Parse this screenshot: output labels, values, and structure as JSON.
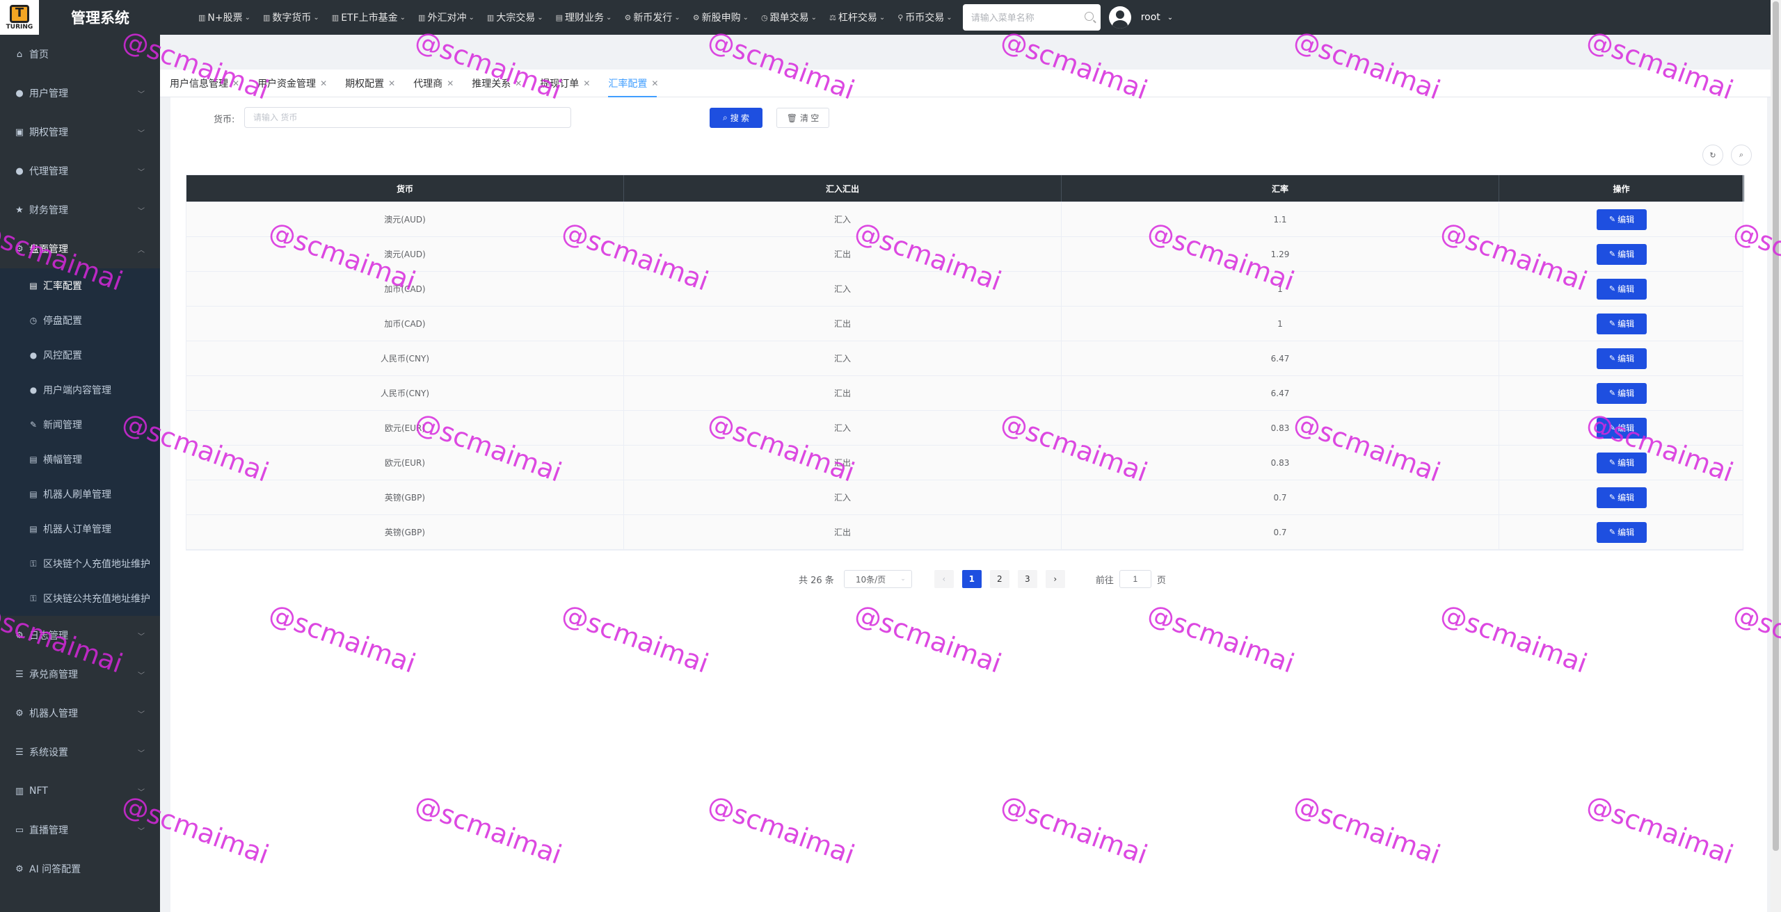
{
  "app": {
    "logo_text": "TURING",
    "logo_mark": "T",
    "title": "管理系统"
  },
  "topnav": [
    {
      "label": "N+股票",
      "icon": "chart-icon"
    },
    {
      "label": "数字货币",
      "icon": "chart-icon"
    },
    {
      "label": "ETF上市基金",
      "icon": "chart-icon"
    },
    {
      "label": "外汇对冲",
      "icon": "chart-icon"
    },
    {
      "label": "大宗交易",
      "icon": "chart-icon"
    },
    {
      "label": "理财业务",
      "icon": "document-icon"
    },
    {
      "label": "新币发行",
      "icon": "gear-icon"
    },
    {
      "label": "新股申购",
      "icon": "gear-icon"
    },
    {
      "label": "跟单交易",
      "icon": "clock-icon"
    },
    {
      "label": "杠杆交易",
      "icon": "scale-icon"
    },
    {
      "label": "币币交易",
      "icon": "pin-icon"
    }
  ],
  "menu_search": {
    "placeholder": "请输入菜单名称"
  },
  "user": {
    "name": "root"
  },
  "sidebar": {
    "items": [
      {
        "label": "首页",
        "icon": "home-icon"
      },
      {
        "label": "用户管理",
        "icon": "user-icon"
      },
      {
        "label": "期权管理",
        "icon": "monitor-icon"
      },
      {
        "label": "代理管理",
        "icon": "user-icon"
      },
      {
        "label": "财务管理",
        "icon": "star-icon"
      },
      {
        "label": "盘面管理",
        "icon": "gear-icon"
      }
    ],
    "sub_items": [
      {
        "label": "汇率配置",
        "icon": "document-icon"
      },
      {
        "label": "停盘配置",
        "icon": "clock-icon"
      },
      {
        "label": "风控配置",
        "icon": "user-icon"
      },
      {
        "label": "用户端内容管理",
        "icon": "user-icon"
      },
      {
        "label": "新闻管理",
        "icon": "edit-icon"
      },
      {
        "label": "横幅管理",
        "icon": "document-icon"
      },
      {
        "label": "机器人刷单管理",
        "icon": "document-icon"
      },
      {
        "label": "机器人订单管理",
        "icon": "document-icon"
      },
      {
        "label": "区块链个人充值地址维护",
        "icon": "lock-icon"
      },
      {
        "label": "区块链公共充值地址维护",
        "icon": "lock-icon"
      }
    ],
    "items_bottom": [
      {
        "label": "日志管理",
        "icon": "gear-icon"
      },
      {
        "label": "承兑商管理",
        "icon": "list-icon"
      },
      {
        "label": "机器人管理",
        "icon": "gear-icon"
      },
      {
        "label": "系统设置",
        "icon": "list-icon"
      },
      {
        "label": "NFT",
        "icon": "chart-icon"
      },
      {
        "label": "直播管理",
        "icon": "video-icon"
      },
      {
        "label": "AI 问答配置",
        "icon": "gear-icon"
      }
    ]
  },
  "tabs": [
    {
      "label": "用户信息管理"
    },
    {
      "label": "用户资金管理"
    },
    {
      "label": "期权配置"
    },
    {
      "label": "代理商"
    },
    {
      "label": "推理关系"
    },
    {
      "label": "提现订单"
    },
    {
      "label": "汇率配置"
    }
  ],
  "filter": {
    "currency_label": "货币:",
    "currency_placeholder": "请输入 货币",
    "search_label": "搜 索",
    "clear_label": "清 空"
  },
  "table": {
    "headers": [
      "货币",
      "汇入汇出",
      "汇率",
      "操作"
    ],
    "edit_label": "编辑",
    "rows": [
      {
        "currency": "澳元(AUD)",
        "direction": "汇入",
        "rate": "1.1"
      },
      {
        "currency": "澳元(AUD)",
        "direction": "汇出",
        "rate": "1.29"
      },
      {
        "currency": "加币(CAD)",
        "direction": "汇入",
        "rate": "1"
      },
      {
        "currency": "加币(CAD)",
        "direction": "汇出",
        "rate": "1"
      },
      {
        "currency": "人民币(CNY)",
        "direction": "汇入",
        "rate": "6.47"
      },
      {
        "currency": "人民币(CNY)",
        "direction": "汇出",
        "rate": "6.47"
      },
      {
        "currency": "欧元(EUR)",
        "direction": "汇入",
        "rate": "0.83"
      },
      {
        "currency": "欧元(EUR)",
        "direction": "汇出",
        "rate": "0.83"
      },
      {
        "currency": "英镑(GBP)",
        "direction": "汇入",
        "rate": "0.7"
      },
      {
        "currency": "英镑(GBP)",
        "direction": "汇出",
        "rate": "0.7"
      }
    ]
  },
  "pagination": {
    "total": "共 26 条",
    "page_size": "10条/页",
    "pages": [
      "1",
      "2",
      "3"
    ],
    "goto_label": "前往",
    "goto_value": "1",
    "page_unit": "页"
  },
  "watermark": "@scmaimai"
}
